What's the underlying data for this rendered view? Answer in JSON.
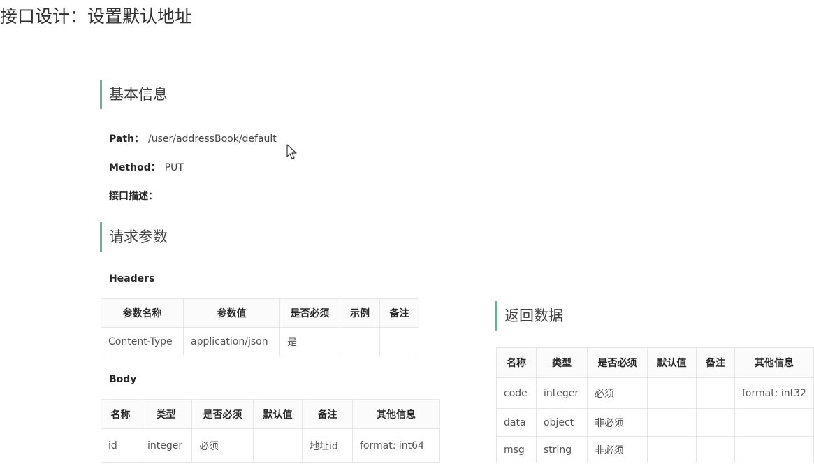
{
  "page": {
    "title": "接口设计：设置默认地址"
  },
  "basic_info": {
    "heading": "基本信息",
    "path_label": "Path：",
    "path_value": "/user/addressBook/default",
    "method_label": "Method：",
    "method_value": "PUT",
    "desc_label": "接口描述："
  },
  "request": {
    "heading": "请求参数",
    "headers": {
      "title": "Headers",
      "columns": [
        "参数名称",
        "参数值",
        "是否必须",
        "示例",
        "备注"
      ],
      "rows": [
        [
          "Content-Type",
          "application/json",
          "是",
          "",
          ""
        ]
      ]
    },
    "body": {
      "title": "Body",
      "columns": [
        "名称",
        "类型",
        "是否必须",
        "默认值",
        "备注",
        "其他信息"
      ],
      "rows": [
        [
          "id",
          "integer",
          "必须",
          "",
          "地址id",
          "format: int64"
        ]
      ]
    }
  },
  "response": {
    "heading": "返回数据",
    "columns": [
      "名称",
      "类型",
      "是否必须",
      "默认值",
      "备注",
      "其他信息"
    ],
    "rows": [
      [
        "code",
        "integer",
        "必须",
        "",
        "",
        "format: int32"
      ],
      [
        "data",
        "object",
        "非必须",
        "",
        "",
        ""
      ],
      [
        "msg",
        "string",
        "非必须",
        "",
        "",
        ""
      ]
    ]
  }
}
